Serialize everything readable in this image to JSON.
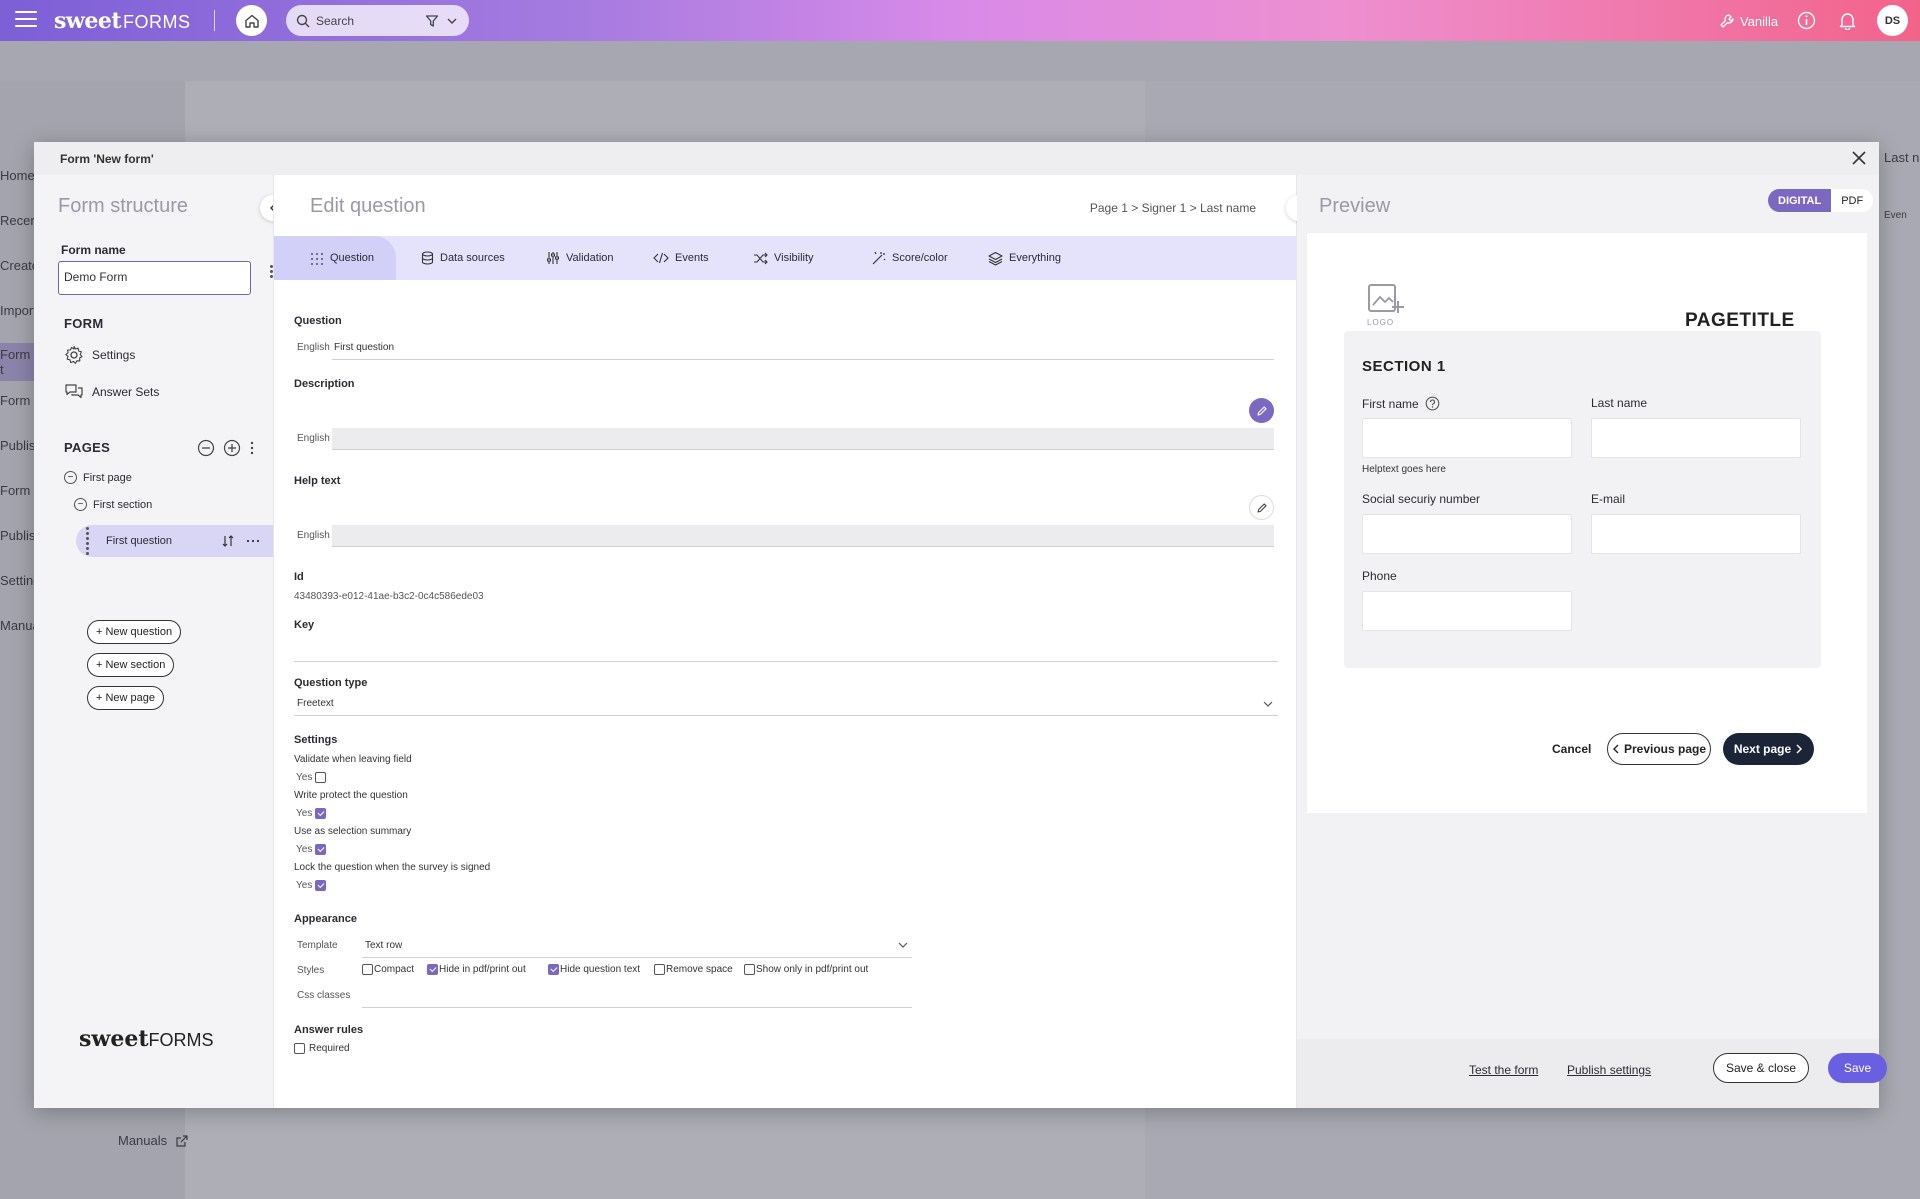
{
  "topbar": {
    "brand_bold": "sweet",
    "brand_light": "FORMS",
    "search_placeholder": "Search",
    "user_label": "Vanilla",
    "avatar_initials": "DS"
  },
  "background": {
    "nav_items": [
      "Home",
      "Recent",
      "Create",
      "Import",
      "Form t",
      "Form d",
      "Publish",
      "Form fi",
      "Publish",
      "Setting",
      "Manua"
    ],
    "right_text": "Last n",
    "right_text2": "Even",
    "manuals": "Manuals"
  },
  "modal": {
    "title": "Form 'New form'"
  },
  "structure": {
    "title": "Form structure",
    "form_name_label": "Form name",
    "form_name_value": "Demo Form",
    "form_heading": "FORM",
    "settings_link": "Settings",
    "answer_sets_link": "Answer Sets",
    "pages_heading": "PAGES",
    "tree": {
      "page": "First page",
      "section": "First section",
      "question": "First question"
    },
    "buttons": {
      "new_question": "New question",
      "new_section": "New section",
      "new_page": "New page"
    },
    "logo_bold": "sweet",
    "logo_light": "FORMS"
  },
  "editor": {
    "title": "Edit question",
    "breadcrumb": "Page 1 > Signer 1 > Last name",
    "tabs": [
      "Question",
      "Data sources",
      "Validation",
      "Events",
      "Visibility",
      "Score/color",
      "Everything"
    ],
    "question_label": "Question",
    "question_lang": "English",
    "question_value": "First question",
    "description_label": "Description",
    "description_lang": "English",
    "help_label": "Help text",
    "help_lang": "English",
    "id_label": "Id",
    "id_value": "43480393-e012-41ae-b3c2-0c4c586ede03",
    "key_label": "Key",
    "qtype_label": "Question type",
    "qtype_value": "Freetext",
    "settings_label": "Settings",
    "settings": [
      {
        "label": "Validate when leaving field",
        "yes": "Yes",
        "checked": false
      },
      {
        "label": "Write protect the question",
        "yes": "Yes",
        "checked": true
      },
      {
        "label": "Use as selection summary",
        "yes": "Yes",
        "checked": true
      },
      {
        "label": "Lock the question when the survey is signed",
        "yes": "Yes",
        "checked": true
      }
    ],
    "appearance_label": "Appearance",
    "template_label": "Template",
    "template_value": "Text row",
    "styles_label": "Styles",
    "styles": [
      {
        "label": "Compact",
        "checked": false
      },
      {
        "label": "Hide in pdf/print out",
        "checked": true
      },
      {
        "label": "Hide question text",
        "checked": true
      },
      {
        "label": "Remove space",
        "checked": false
      },
      {
        "label": "Show only in pdf/print out",
        "checked": false
      }
    ],
    "css_label": "Css classes",
    "answer_rules_label": "Answer rules",
    "required_label": "Required"
  },
  "preview": {
    "title": "Preview",
    "digital": "DIGITAL",
    "pdf": "PDF",
    "logo_text": "LOGO",
    "pagetitle": "PAGETITLE",
    "section_title": "SECTION 1",
    "first_name": "First name",
    "last_name": "Last name",
    "helptext": "Helptext goes here",
    "ssn": "Social securiy number",
    "email": "E-mail",
    "phone": "Phone",
    "cancel": "Cancel",
    "previous": "Previous page",
    "next": "Next page"
  },
  "footer": {
    "test": "Test the form",
    "publish_settings": "Publish settings",
    "save_close": "Save & close",
    "save": "Save"
  },
  "colors": {
    "accent": "#7b68c0",
    "tab_bg": "#e4e3fb",
    "dark_button": "#1c2538",
    "save_button": "#6a5fe0"
  }
}
